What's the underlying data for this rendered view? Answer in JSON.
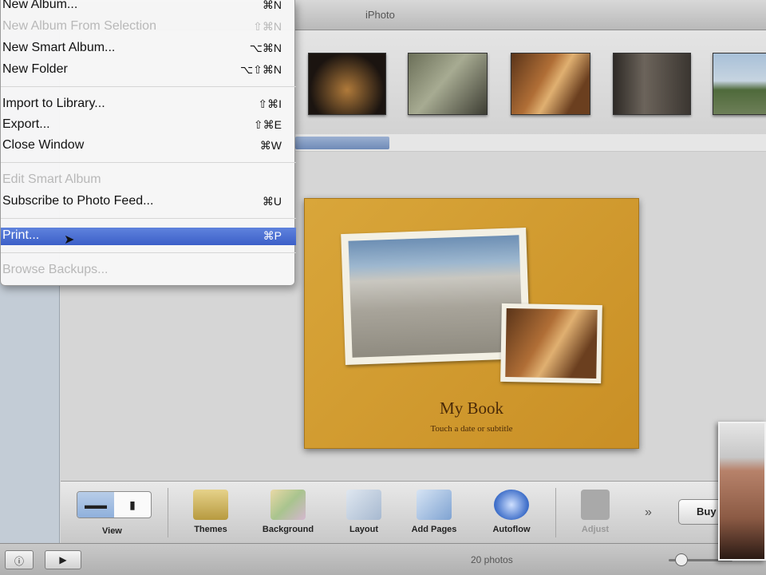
{
  "window": {
    "title": "iPhoto"
  },
  "menu": {
    "items": [
      {
        "label": "New Album...",
        "shortcut": "⌘N",
        "enabled": true
      },
      {
        "label": "New Album From Selection",
        "shortcut": "⇧⌘N",
        "enabled": false
      },
      {
        "label": "New Smart Album...",
        "shortcut": "⌥⌘N",
        "enabled": true
      },
      {
        "label": "New Folder",
        "shortcut": "⌥⇧⌘N",
        "enabled": true
      },
      {
        "label": "Import to Library...",
        "shortcut": "⇧⌘I",
        "enabled": true
      },
      {
        "label": "Export...",
        "shortcut": "⇧⌘E",
        "enabled": true
      },
      {
        "label": "Close Window",
        "shortcut": "⌘W",
        "enabled": true
      },
      {
        "label": "Edit Smart Album",
        "shortcut": "",
        "enabled": false
      },
      {
        "label": "Subscribe to Photo Feed...",
        "shortcut": "⌘U",
        "enabled": true
      },
      {
        "label": "Print...",
        "shortcut": "⌘P",
        "enabled": true,
        "highlighted": true
      },
      {
        "label": "Browse Backups...",
        "shortcut": "",
        "enabled": false
      }
    ]
  },
  "book": {
    "title": "My Book",
    "subtitle": "Touch a date or subtitle"
  },
  "toolbar": {
    "view_label": "View",
    "tools": [
      {
        "label": "Themes",
        "icon": "themes-icon",
        "color": "#c9b45a"
      },
      {
        "label": "Background",
        "icon": "background-icon",
        "color": "#b7c9a0"
      },
      {
        "label": "Layout",
        "icon": "layout-icon",
        "color": "#a7b9d0"
      },
      {
        "label": "Add Pages",
        "icon": "add-pages-icon",
        "color": "#8fb0d8"
      },
      {
        "label": "Autoflow",
        "icon": "autoflow-icon",
        "color": "#4f7fcf"
      },
      {
        "label": "Adjust",
        "icon": "adjust-icon",
        "color": "#9a9a9a"
      }
    ],
    "buy_label": "Buy"
  },
  "status": {
    "photo_count": "20 photos"
  },
  "colors": {
    "selection": "#3c5fc8",
    "book_cover": "#d9a63a"
  }
}
